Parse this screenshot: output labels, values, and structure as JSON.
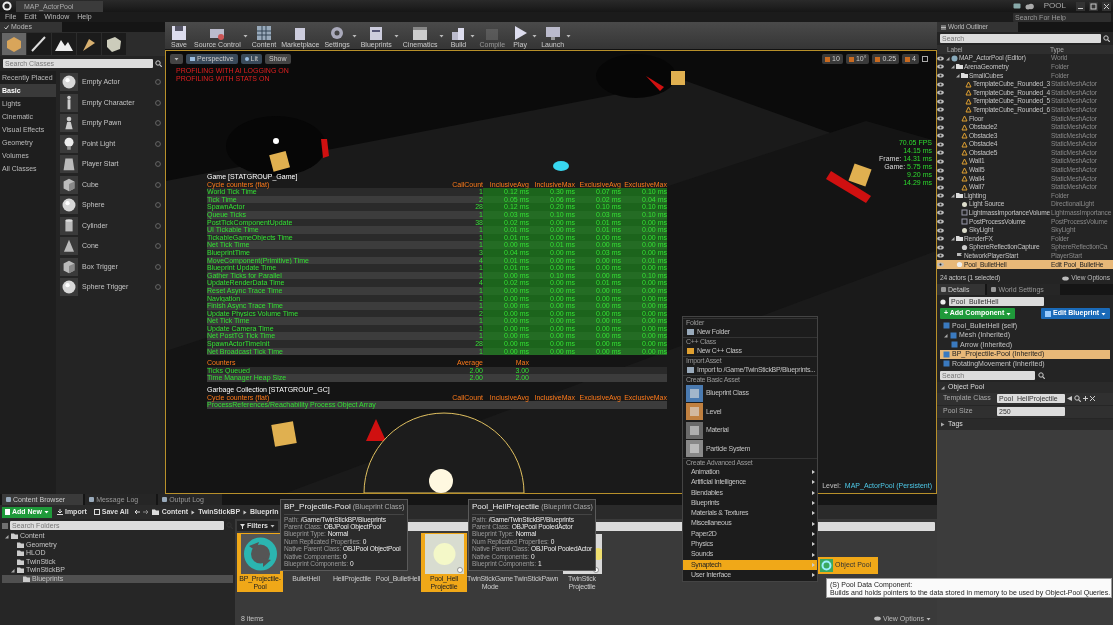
{
  "titlebar": {
    "tab": "MAP_ActorPool",
    "project": "POOL"
  },
  "menubar": {
    "items": [
      "File",
      "Edit",
      "Window",
      "Help"
    ],
    "help_search": {
      "placeholder": "Search For Help"
    }
  },
  "modes": {
    "tab": "Modes",
    "tools": [
      {
        "kind": "place",
        "selected": true
      },
      {
        "kind": "paint",
        "selected": false
      },
      {
        "kind": "landscape",
        "selected": false
      },
      {
        "kind": "foliage",
        "selected": false
      },
      {
        "kind": "geometry",
        "selected": false
      }
    ],
    "search": {
      "placeholder": "Search Classes"
    },
    "categories": [
      {
        "label": "Recently Placed",
        "selected": false
      },
      {
        "label": "Basic",
        "selected": true
      },
      {
        "label": "Lights",
        "selected": false
      },
      {
        "label": "Cinematic",
        "selected": false
      },
      {
        "label": "Visual Effects",
        "selected": false
      },
      {
        "label": "Geometry",
        "selected": false
      },
      {
        "label": "Volumes",
        "selected": false
      },
      {
        "label": "All Classes",
        "selected": false
      }
    ],
    "items": [
      {
        "label": "Empty Actor",
        "kind": "sphere"
      },
      {
        "label": "Empty Character",
        "kind": "figure"
      },
      {
        "label": "Empty Pawn",
        "kind": "pawn"
      },
      {
        "label": "Point Light",
        "kind": "bulb"
      },
      {
        "label": "Player Start",
        "kind": "start"
      },
      {
        "label": "Cube",
        "kind": "cube"
      },
      {
        "label": "Sphere",
        "kind": "sphere"
      },
      {
        "label": "Cylinder",
        "kind": "cylinder"
      },
      {
        "label": "Cone",
        "kind": "cone"
      },
      {
        "label": "Box Trigger",
        "kind": "cube"
      },
      {
        "label": "Sphere Trigger",
        "kind": "sphere"
      }
    ]
  },
  "toolbar": {
    "buttons": [
      {
        "label": "Save",
        "kind": "save",
        "menu": false,
        "disabled": false
      },
      {
        "label": "Source Control",
        "kind": "source",
        "menu": true,
        "disabled": false
      },
      {
        "label": "Content",
        "kind": "content",
        "menu": false,
        "disabled": false
      },
      {
        "label": "Marketplace",
        "kind": "market",
        "menu": false,
        "disabled": false
      },
      {
        "label": "Settings",
        "kind": "settings",
        "menu": true,
        "disabled": false
      },
      {
        "label": "Blueprints",
        "kind": "blueprints",
        "menu": true,
        "disabled": false
      },
      {
        "label": "Cinematics",
        "kind": "cinematics",
        "menu": true,
        "disabled": false
      },
      {
        "label": "Build",
        "kind": "build",
        "menu": true,
        "disabled": false
      },
      {
        "label": "Compile",
        "kind": "compile",
        "menu": false,
        "disabled": true
      },
      {
        "label": "Play",
        "kind": "play",
        "menu": true,
        "disabled": false
      },
      {
        "label": "Launch",
        "kind": "launch",
        "menu": true,
        "disabled": false
      }
    ]
  },
  "viewport": {
    "buttons": [
      {
        "label": "Perspective",
        "kind": "camera"
      },
      {
        "label": "Lit",
        "kind": "lit"
      },
      {
        "label": "Show",
        "kind": "none"
      }
    ],
    "snaps": [
      "10",
      "10°",
      "0.25",
      "4"
    ],
    "messages": [
      "PROFILING WITH AI LOGGING ON",
      "PROFILING WITH STATS ON"
    ],
    "fps_lines": [
      "70.05 FPS",
      "14.15 ms"
    ],
    "timings": [
      {
        "label": "Frame:",
        "value": "14.31 ms"
      },
      {
        "label": "Game:",
        "value": "5.75 ms"
      }
    ],
    "timing_values": [
      "9.20 ms",
      "14.29 ms"
    ],
    "stats": {
      "title": "Game [STATGROUP_Game]",
      "columns": [
        "Cycle counters (flat)",
        "CallCount",
        "InclusiveAvg",
        "InclusiveMax",
        "ExclusiveAvg",
        "ExclusiveMax"
      ],
      "rows": [
        {
          "cells": [
            "World Tick Time",
            "1",
            "0.12 ms",
            "0.30 ms",
            "0.07 ms",
            "0.10 ms"
          ]
        },
        {
          "cells": [
            "Tick Time",
            "2",
            "0.05 ms",
            "0.06 ms",
            "0.02 ms",
            "0.04 ms"
          ]
        },
        {
          "cells": [
            "SpawnActor",
            "28",
            "0.12 ms",
            "0.20 ms",
            "0.10 ms",
            "0.10 ms"
          ]
        },
        {
          "cells": [
            "Queue Ticks",
            "1",
            "0.03 ms",
            "0.10 ms",
            "0.03 ms",
            "0.10 ms"
          ]
        },
        {
          "cells": [
            "PostTickComponentUpdate",
            "38",
            "0.02 ms",
            "0.00 ms",
            "0.01 ms",
            "0.00 ms"
          ]
        },
        {
          "cells": [
            "UI Tickable Time",
            "1",
            "0.01 ms",
            "0.00 ms",
            "0.01 ms",
            "0.00 ms"
          ]
        },
        {
          "cells": [
            "TickableGameObjects Time",
            "1",
            "0.01 ms",
            "0.00 ms",
            "0.00 ms",
            "0.00 ms"
          ]
        },
        {
          "cells": [
            "Net Tick Time",
            "1",
            "0.00 ms",
            "0.01 ms",
            "0.00 ms",
            "0.00 ms"
          ]
        },
        {
          "cells": [
            "BlueprintTime",
            "3",
            "0.04 ms",
            "0.00 ms",
            "0.03 ms",
            "0.00 ms"
          ]
        },
        {
          "cells": [
            "MoveComponent(Primitive) Time",
            "4",
            "0.01 ms",
            "0.00 ms",
            "0.00 ms",
            "0.01 ms"
          ]
        },
        {
          "cells": [
            "Blueprint Update Time",
            "1",
            "0.01 ms",
            "0.00 ms",
            "0.00 ms",
            "0.00 ms"
          ]
        },
        {
          "cells": [
            "Gather Ticks for Parallel",
            "1",
            "0.00 ms",
            "0.10 ms",
            "0.00 ms",
            "0.10 ms"
          ]
        },
        {
          "cells": [
            "UpdateRenderData Time",
            "4",
            "0.02 ms",
            "0.00 ms",
            "0.01 ms",
            "0.00 ms"
          ]
        },
        {
          "cells": [
            "Reset Async Trace Time",
            "1",
            "0.00 ms",
            "0.00 ms",
            "0.00 ms",
            "0.00 ms"
          ]
        },
        {
          "cells": [
            "Navigation",
            "1",
            "0.00 ms",
            "0.00 ms",
            "0.00 ms",
            "0.00 ms"
          ]
        },
        {
          "cells": [
            "Finish Async Trace Time",
            "1",
            "0.00 ms",
            "0.00 ms",
            "0.00 ms",
            "0.00 ms"
          ]
        },
        {
          "cells": [
            "Update Physics Volume Time",
            "2",
            "0.00 ms",
            "0.00 ms",
            "0.00 ms",
            "0.00 ms"
          ]
        },
        {
          "cells": [
            "Net Tick Time",
            "1",
            "0.00 ms",
            "0.00 ms",
            "0.00 ms",
            "0.00 ms"
          ]
        },
        {
          "cells": [
            "Update Camera Time",
            "1",
            "0.00 ms",
            "0.00 ms",
            "0.00 ms",
            "0.00 ms"
          ]
        },
        {
          "cells": [
            "Net PostTG Tick Time",
            "1",
            "0.00 ms",
            "0.00 ms",
            "0.00 ms",
            "0.00 ms"
          ]
        },
        {
          "cells": [
            "SpawnActorTimeInit",
            "28",
            "0.00 ms",
            "0.00 ms",
            "0.00 ms",
            "0.00 ms"
          ]
        },
        {
          "cells": [
            "Net Broadcast Tick Time",
            "1",
            "0.00 ms",
            "0.00 ms",
            "0.00 ms",
            "0.00 ms"
          ]
        }
      ]
    },
    "counters": {
      "columns": [
        "Counters",
        "Average",
        "Max"
      ],
      "rows": [
        {
          "cells": [
            "Ticks Queued",
            "2.00",
            "3.00"
          ]
        },
        {
          "cells": [
            "Time Manager Heap Size",
            "2.00",
            "2.00"
          ]
        }
      ]
    },
    "gc": {
      "title": "Garbage Collection [STATGROUP_GC]",
      "columns": [
        "Cycle counters (flat)",
        "CallCount",
        "InclusiveAvg",
        "InclusiveMax",
        "ExclusiveAvg",
        "ExclusiveMax"
      ],
      "rows": [
        {
          "cells": [
            "ProcessReferences/Reachability Process Object Array"
          ]
        }
      ]
    },
    "level_label": "Level:",
    "level_name": "MAP_ActorPool (Persistent)"
  },
  "outliner": {
    "tab": "World Outliner",
    "search": {
      "placeholder": "Search"
    },
    "columns": [
      "Label",
      "Type"
    ],
    "rows": [
      {
        "label": "MAP_ActorPool (Editor)",
        "type": "World",
        "kind": "world",
        "expanded": true,
        "selected": false,
        "children": [
          {
            "label": "ArenaGeometry",
            "type": "Folder",
            "kind": "folder",
            "expanded": true,
            "selected": false,
            "children": [
              {
                "label": "SmallCubes",
                "type": "Folder",
                "kind": "folder",
                "expanded": true,
                "selected": false,
                "children": [
                  {
                    "label": "TemplateCube_Rounded_3",
                    "type": "StaticMeshActor",
                    "kind": "mesh",
                    "selected": false
                  },
                  {
                    "label": "TemplateCube_Rounded_4",
                    "type": "StaticMeshActor",
                    "kind": "mesh",
                    "selected": false
                  },
                  {
                    "label": "TemplateCube_Rounded_5",
                    "type": "StaticMeshActor",
                    "kind": "mesh",
                    "selected": false
                  },
                  {
                    "label": "TemplateCube_Rounded_6",
                    "type": "StaticMeshActor",
                    "kind": "mesh",
                    "selected": false
                  }
                ]
              },
              {
                "label": "Floor",
                "type": "StaticMeshActor",
                "kind": "mesh",
                "selected": false
              },
              {
                "label": "Obstacle2",
                "type": "StaticMeshActor",
                "kind": "mesh",
                "selected": false
              },
              {
                "label": "Obstacle3",
                "type": "StaticMeshActor",
                "kind": "mesh",
                "selected": false
              },
              {
                "label": "Obstacle4",
                "type": "StaticMeshActor",
                "kind": "mesh",
                "selected": false
              },
              {
                "label": "Obstacle5",
                "type": "StaticMeshActor",
                "kind": "mesh",
                "selected": false
              },
              {
                "label": "Wall1",
                "type": "StaticMeshActor",
                "kind": "mesh",
                "selected": false
              },
              {
                "label": "Wall5",
                "type": "StaticMeshActor",
                "kind": "mesh",
                "selected": false
              },
              {
                "label": "Wall4",
                "type": "StaticMeshActor",
                "kind": "mesh",
                "selected": false
              },
              {
                "label": "Wall7",
                "type": "StaticMeshActor",
                "kind": "mesh",
                "selected": false
              }
            ]
          },
          {
            "label": "Lighting",
            "type": "Folder",
            "kind": "folder",
            "expanded": true,
            "selected": false,
            "children": [
              {
                "label": "Light Source",
                "type": "DirectionalLight",
                "kind": "light",
                "selected": false
              },
              {
                "label": "LightmassImportanceVolume",
                "type": "LightmassImportance",
                "kind": "volume",
                "selected": false
              },
              {
                "label": "PostProcessVolume",
                "type": "PostProcessVolume",
                "kind": "volume",
                "selected": false
              },
              {
                "label": "SkyLight",
                "type": "SkyLight",
                "kind": "light",
                "selected": false
              }
            ]
          },
          {
            "label": "RenderFX",
            "type": "Folder",
            "kind": "folder",
            "expanded": true,
            "selected": false,
            "children": [
              {
                "label": "SphereReflectionCapture",
                "type": "SphereReflectionCa",
                "kind": "capture",
                "selected": false
              }
            ]
          },
          {
            "label": "NetworkPlayerStart",
            "type": "PlayerStart",
            "kind": "start",
            "selected": false
          },
          {
            "label": "Pool_BulletHell",
            "type": "Edit Pool_BulletHe",
            "kind": "pool",
            "selected": true
          }
        ]
      }
    ],
    "footer": "24 actors (1 selected)",
    "view_options": "View Options"
  },
  "details": {
    "tabs": [
      {
        "label": "Details",
        "selected": true
      },
      {
        "label": "World Settings",
        "selected": false
      }
    ],
    "name": "Pool_BulletHell",
    "add_component": "+ Add Component",
    "edit_blueprint": "Edit Blueprint",
    "components": [
      {
        "label": "Pool_BulletHell (self)",
        "selected": false
      },
      {
        "label": "Mesh (Inherited)",
        "selected": false,
        "expanded": true,
        "children": [
          {
            "label": "Arrow (Inherited)",
            "selected": false
          }
        ]
      },
      {
        "label": "BP_Projectile-Pool (Inherited)",
        "selected": true
      },
      {
        "label": "RotatingMovement (Inherited)",
        "selected": false
      }
    ],
    "search": {
      "placeholder": "Search"
    },
    "section": "Object Pool",
    "properties": [
      {
        "label": "Template Class",
        "value": "Pool_HellProjectile",
        "kind": "class"
      },
      {
        "label": "Pool Size",
        "value": "250",
        "kind": "number"
      }
    ],
    "collapsed_section": "Tags"
  },
  "content_browser": {
    "tabs": [
      {
        "label": "Content Browser",
        "selected": true
      },
      {
        "label": "Message Log",
        "selected": false
      },
      {
        "label": "Output Log",
        "selected": false
      }
    ],
    "add_new": "Add New",
    "import": "Import",
    "save_all": "Save All",
    "path": [
      "Content",
      "TwinStickBP",
      "Blueprin"
    ],
    "folder_search": {
      "placeholder": "Search Folders"
    },
    "folders": [
      {
        "label": "Content",
        "expanded": true,
        "selected": false,
        "children": [
          {
            "label": "Geometry",
            "selected": false
          },
          {
            "label": "HLOD",
            "selected": false
          },
          {
            "label": "TwinStick",
            "selected": false
          },
          {
            "label": "TwinStickBP",
            "expanded": true,
            "selected": false,
            "children": [
              {
                "label": "Blueprints",
                "selected": true
              }
            ]
          }
        ]
      }
    ],
    "filters": "Filters",
    "assets": [
      {
        "label": "BP_Projectile-Pool",
        "kind": "pool",
        "selected": true
      },
      {
        "label": "BulletHell",
        "kind": "covered",
        "selected": false
      },
      {
        "label": "HellProjectile",
        "kind": "covered",
        "selected": false
      },
      {
        "label": "Pool_BulletHell",
        "kind": "covered",
        "selected": false
      },
      {
        "label": "Pool_Hell Projectile",
        "kind": "glow",
        "selected": true
      },
      {
        "label": "TwinStickGame Mode",
        "kind": "covered",
        "selected": false
      },
      {
        "label": "TwinStickPawn",
        "kind": "covered",
        "selected": false
      },
      {
        "label": "TwinStick Projectile",
        "kind": "white",
        "selected": false
      }
    ],
    "count": "8 items",
    "view_options": "View Options"
  },
  "asset_tooltips": [
    {
      "title": "BP_Projectile-Pool",
      "type": "(Blueprint Class)",
      "lines": [
        {
          "label": "Path:",
          "value": "/Game/TwinStickBP/Blueprints"
        },
        {
          "label": "Parent Class:",
          "value": "OBJPool ObjectPool"
        },
        {
          "label": "Blueprint Type:",
          "value": "Normal"
        },
        {
          "label": "Num Replicated Properties:",
          "value": "0"
        },
        {
          "label": "Native Parent Class:",
          "value": "OBJPool ObjectPool"
        },
        {
          "label": "Native Components:",
          "value": "0"
        },
        {
          "label": "Blueprint Components:",
          "value": "0"
        }
      ]
    },
    {
      "title": "Pool_HellProjectile",
      "type": "(Blueprint Class)",
      "lines": [
        {
          "label": "Path:",
          "value": "/Game/TwinStickBP/Blueprints"
        },
        {
          "label": "Parent Class:",
          "value": "OBJPool PooledActor"
        },
        {
          "label": "Blueprint Type:",
          "value": "Normal"
        },
        {
          "label": "Num Replicated Properties:",
          "value": "0"
        },
        {
          "label": "Native Parent Class:",
          "value": "OBJPool PooledActor"
        },
        {
          "label": "Native Components:",
          "value": "0"
        },
        {
          "label": "Blueprint Components:",
          "value": "1"
        }
      ]
    }
  ],
  "context_menu": {
    "sections": [
      {
        "header": "Folder",
        "items": [
          {
            "label": "New Folder",
            "kind": "folder"
          }
        ]
      },
      {
        "header": "C++ Class",
        "items": [
          {
            "label": "New C++ Class",
            "kind": "cpp"
          }
        ]
      },
      {
        "header": "Import Asset",
        "items": [
          {
            "label": "Import to /Game/TwinStickBP/Blueprints...",
            "kind": "import"
          }
        ]
      },
      {
        "header": "Create Basic Asset",
        "items": [
          {
            "label": "Blueprint Class",
            "kind": "blueprint"
          },
          {
            "label": "Level",
            "kind": "level"
          },
          {
            "label": "Material",
            "kind": "material"
          },
          {
            "label": "Particle System",
            "kind": "particle"
          }
        ]
      },
      {
        "header": "Create Advanced Asset",
        "items": [
          {
            "label": "Animation",
            "kind": "submenu",
            "selected": false
          },
          {
            "label": "Artificial Intelligence",
            "kind": "submenu",
            "selected": false
          },
          {
            "label": "Blendables",
            "kind": "submenu",
            "selected": false
          },
          {
            "label": "Blueprints",
            "kind": "submenu",
            "selected": false
          },
          {
            "label": "Materials & Textures",
            "kind": "submenu",
            "selected": false
          },
          {
            "label": "Miscellaneous",
            "kind": "submenu",
            "selected": false
          },
          {
            "label": "Paper2D",
            "kind": "submenu",
            "selected": false
          },
          {
            "label": "Physics",
            "kind": "submenu",
            "selected": false
          },
          {
            "label": "Sounds",
            "kind": "submenu",
            "selected": false
          },
          {
            "label": "Synaptech",
            "kind": "submenu",
            "selected": true
          },
          {
            "label": "User Interface",
            "kind": "submenu",
            "selected": false
          }
        ]
      }
    ],
    "submenu": {
      "label": "Object Pool"
    },
    "tooltip": {
      "title": "(S) Pool Data Component:",
      "text": "Builds and holds pointers to the data stored in memory to be used by Object-Pool Queries."
    }
  }
}
